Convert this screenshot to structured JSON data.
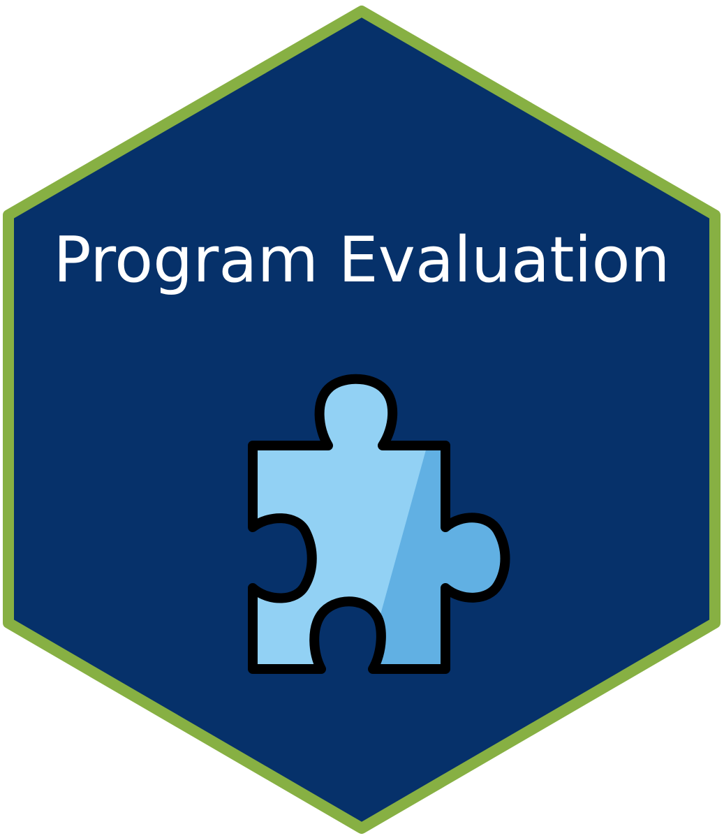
{
  "badge": {
    "title": "Program Evaluation",
    "icon": "puzzle-piece-icon",
    "colors": {
      "hex_fill": "#06316a",
      "hex_border": "#87b043",
      "title_text": "#ffffff",
      "puzzle_light": "#92d1f4",
      "puzzle_shade": "#61b0e3",
      "puzzle_outline": "#000000"
    }
  }
}
